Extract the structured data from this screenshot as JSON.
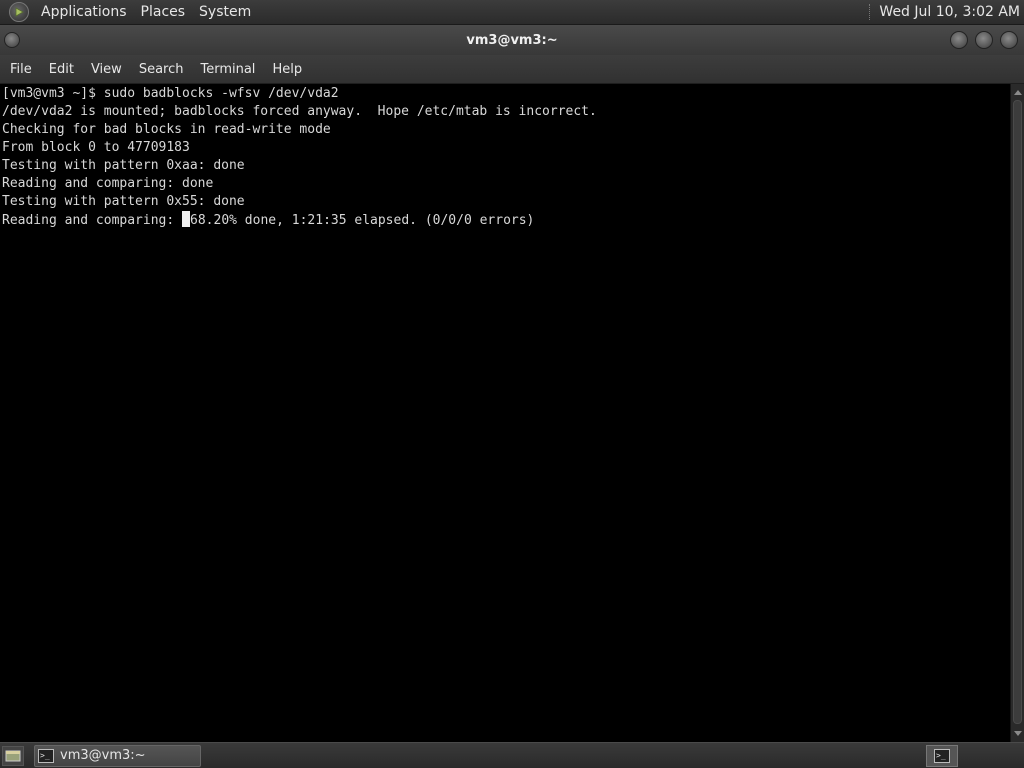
{
  "top_panel": {
    "menus": [
      "Applications",
      "Places",
      "System"
    ],
    "clock": "Wed Jul 10,  3:02 AM"
  },
  "window": {
    "title": "vm3@vm3:~"
  },
  "menubar": {
    "items": [
      "File",
      "Edit",
      "View",
      "Search",
      "Terminal",
      "Help"
    ]
  },
  "terminal": {
    "lines": [
      "[vm3@vm3 ~]$ sudo badblocks -wfsv /dev/vda2",
      "/dev/vda2 is mounted; badblocks forced anyway.  Hope /etc/mtab is incorrect.",
      "Checking for bad blocks in read-write mode",
      "From block 0 to 47709183",
      "Testing with pattern 0xaa: done",
      "Reading and comparing: done",
      "Testing with pattern 0x55: done"
    ],
    "current_prefix": "Reading and comparing: ",
    "current_suffix": "68.20% done, 1:21:35 elapsed. (0/0/0 errors)"
  },
  "taskbar": {
    "window_button": "vm3@vm3:~",
    "terminal_icon_glyph": ">_"
  },
  "icons": {
    "app_menu": "gnome-foot-icon",
    "window_menu": "window-menu-icon",
    "minimize": "minimize-icon",
    "maximize": "maximize-icon",
    "close": "close-icon",
    "show_desktop": "show-desktop-icon",
    "terminal": "terminal-icon"
  },
  "colors": {
    "terminal_bg": "#000000",
    "terminal_fg": "#d8d8d8",
    "panel_bg": "#333333"
  }
}
